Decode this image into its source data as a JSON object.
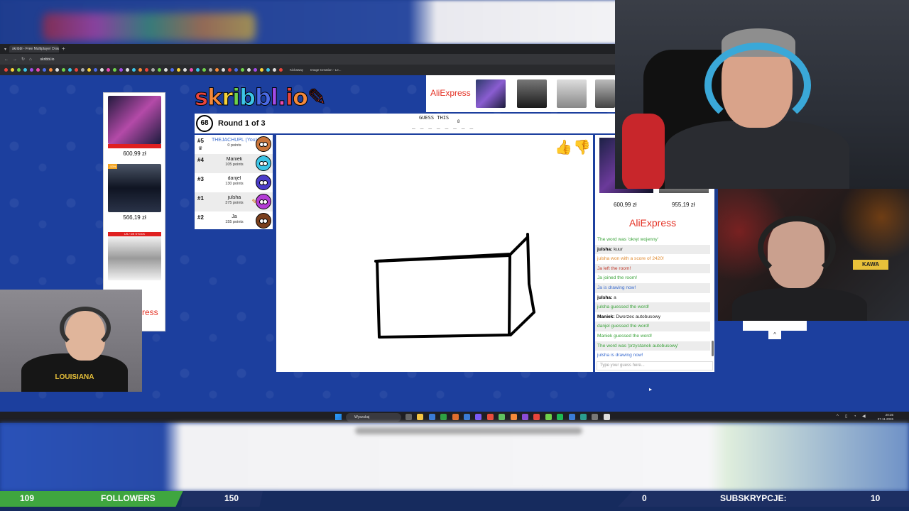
{
  "browser": {
    "tab_title": "skribbl - Free Multiplayer Draw...",
    "url": "skribbl.io",
    "bookmark_labels": [
      "Kickaway",
      "Image Creation - Le..."
    ]
  },
  "game": {
    "logo_text": "skribbl.io",
    "timer": "68",
    "round": "Round 1 of 3",
    "guess_label": "GUESS THIS",
    "word_hint": "_ _ _ _ _ _ _ _",
    "word_length": "8",
    "players": [
      {
        "rank": "#5",
        "name": "THEJACHUPL (You)",
        "points": "0 points",
        "color": "#c8743a",
        "is_you": true,
        "crown": true
      },
      {
        "rank": "#4",
        "name": "Maniek",
        "points": "105 points",
        "color": "#3cc4e6"
      },
      {
        "rank": "#3",
        "name": "danjel",
        "points": "130 points",
        "color": "#4b3cc9"
      },
      {
        "rank": "#1",
        "name": "julsha",
        "points": "375 points",
        "color": "#b43dd6",
        "drawing": true
      },
      {
        "rank": "#2",
        "name": "Ja",
        "points": "155 points",
        "color": "#7a3f1c"
      }
    ]
  },
  "ads": {
    "brand": "AliExpress",
    "left_prices": [
      "600,99 zł",
      "566,19 zł"
    ],
    "left_badge": "-53%",
    "left_bar": "US / DE STOCK",
    "right_prices": [
      "600,99 zł",
      "955,19 zł"
    ]
  },
  "chat": {
    "messages": [
      {
        "author": "",
        "text": "The word was 'okręt wojenny'",
        "color": "#3aa33a"
      },
      {
        "author": "julsha",
        "text": "kuur",
        "color": "#222"
      },
      {
        "author": "",
        "text": "julsha won with a score of 2420!",
        "color": "#e08a2e"
      },
      {
        "author": "",
        "text": "Ja left the room!",
        "color": "#c0392b"
      },
      {
        "author": "",
        "text": "Ja joined the room!",
        "color": "#3aa33a"
      },
      {
        "author": "",
        "text": "Ja is drawing now!",
        "color": "#3b6ccf"
      },
      {
        "author": "julsha",
        "text": "a",
        "color": "#222"
      },
      {
        "author": "",
        "text": "julsha guessed the word!",
        "color": "#3aa33a"
      },
      {
        "author": "Maniek",
        "text": "Dworzec autobusowy",
        "color": "#222"
      },
      {
        "author": "",
        "text": "danjel guessed the word!",
        "color": "#3aa33a"
      },
      {
        "author": "",
        "text": "Maniek guessed the word!",
        "color": "#3aa33a"
      },
      {
        "author": "",
        "text": "The word was 'przystanek autobusowy'",
        "color": "#3aa33a"
      },
      {
        "author": "",
        "text": "julsha is drawing now!",
        "color": "#3b6ccf"
      }
    ],
    "input_placeholder": "Type your guess here..."
  },
  "taskbar": {
    "search_label": "Wyszukaj",
    "time": "20:35",
    "date": "07.11.2026"
  },
  "overlay": {
    "followers_current": "109",
    "followers_label": "FOLLOWERS",
    "followers_goal": "150",
    "followers_progress": 0.726,
    "subs_current": "0",
    "subs_label": "SUBSKRYPCJE:",
    "subs_goal": "10",
    "follower_color": "#3fa63f"
  }
}
